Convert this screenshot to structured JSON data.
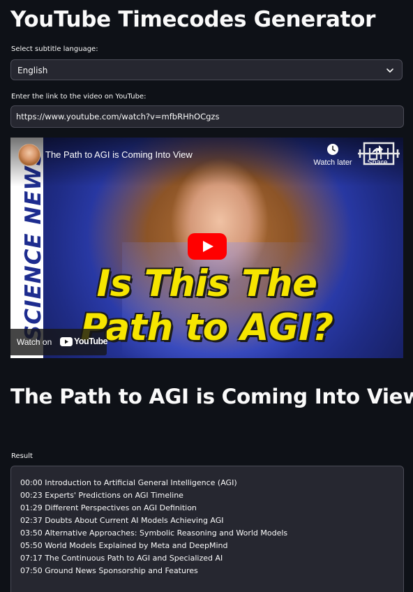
{
  "app": {
    "title": "YouTube Timecodes Generator"
  },
  "language_select": {
    "label": "Select subtitle language:",
    "value": "English"
  },
  "url_input": {
    "label": "Enter the link to the video on YouTube:",
    "value": "https://www.youtube.com/watch?v=mfbRHhOCgzs"
  },
  "video_embed": {
    "title": "The Path to AGI is Coming Into View",
    "watch_later_label": "Watch later",
    "share_label": "Share",
    "watch_on_label": "Watch on",
    "youtube_logo_text": "YouTube",
    "thumbnail_overlay_line1": "Is This The",
    "thumbnail_overlay_line2": "Path to AGI?",
    "thumbnail_sidebar_text": "SCIENCE NEWS",
    "accent_color": "#f6e500"
  },
  "video_heading": "The Path to AGI is Coming Into View",
  "result": {
    "label": "Result",
    "lines": [
      "00:00 Introduction to Artificial General Intelligence (AGI)",
      "00:23 Experts' Predictions on AGI Timeline",
      "01:29 Different Perspectives on AGI Definition",
      "02:37 Doubts About Current AI Models Achieving AGI",
      "03:50 Alternative Approaches: Symbolic Reasoning and World Models",
      "05:50 World Models Explained by Meta and DeepMind",
      "07:17 The Continuous Path to AGI and Specialized AI",
      "07:50 Ground News Sponsorship and Features"
    ]
  },
  "icons": {
    "chevron": "chevron-down-icon",
    "watch_later": "clock-icon",
    "share": "share-icon",
    "play": "play-icon"
  }
}
